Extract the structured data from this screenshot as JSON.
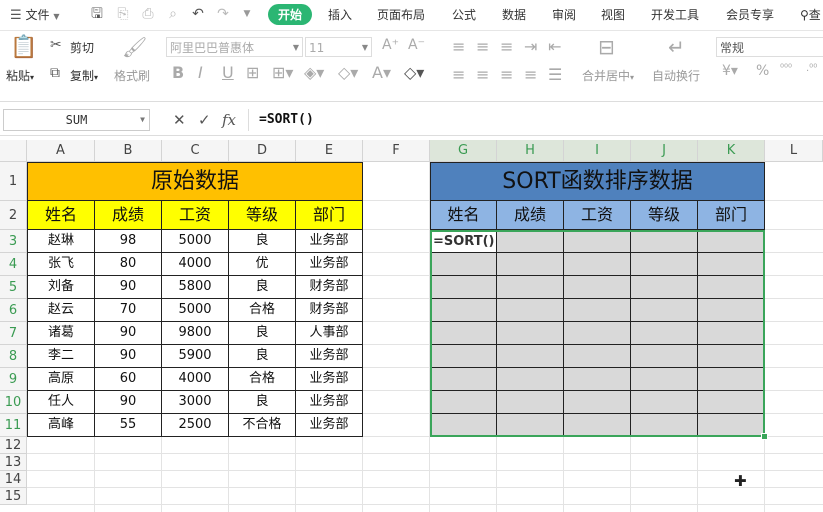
{
  "menubar": {
    "file": "文件",
    "tabs": [
      "开始",
      "插入",
      "页面布局",
      "公式",
      "数据",
      "审阅",
      "视图",
      "开发工具",
      "会员专享"
    ],
    "active_tab": "开始",
    "search_partial": "查"
  },
  "ribbon": {
    "paste": "粘贴",
    "cut": "剪切",
    "copy": "复制",
    "format_painter": "格式刷",
    "font_name": "阿里巴巴普惠体",
    "font_size": "11",
    "merge_center": "合并居中",
    "wrap_text": "自动换行",
    "number_format": "常规"
  },
  "formula_bar": {
    "name_box": "SUM",
    "formula": "=SORT()"
  },
  "sheet": {
    "columns": [
      "A",
      "B",
      "C",
      "D",
      "E",
      "F",
      "G",
      "H",
      "I",
      "J",
      "K",
      "L"
    ],
    "rows": [
      "1",
      "2",
      "3",
      "4",
      "5",
      "6",
      "7",
      "8",
      "9",
      "10",
      "11",
      "12",
      "13",
      "14",
      "15"
    ],
    "left_title": "原始数据",
    "right_title": "SORT函数排序数据",
    "headers": [
      "姓名",
      "成绩",
      "工资",
      "等级",
      "部门"
    ],
    "data": [
      [
        "赵琳",
        "98",
        "5000",
        "良",
        "业务部"
      ],
      [
        "张飞",
        "80",
        "4000",
        "优",
        "业务部"
      ],
      [
        "刘备",
        "90",
        "5800",
        "良",
        "财务部"
      ],
      [
        "赵云",
        "70",
        "5000",
        "合格",
        "财务部"
      ],
      [
        "诸葛",
        "90",
        "9800",
        "良",
        "人事部"
      ],
      [
        "李二",
        "90",
        "5900",
        "良",
        "业务部"
      ],
      [
        "高原",
        "60",
        "4000",
        "合格",
        "业务部"
      ],
      [
        "任人",
        "90",
        "3000",
        "良",
        "业务部"
      ],
      [
        "高峰",
        "55",
        "2500",
        "不合格",
        "业务部"
      ]
    ],
    "editing_cell_text": "=SORT()"
  },
  "colors": {
    "accent": "#2bb673",
    "left_title_bg": "#ffc000",
    "left_header_bg": "#ffff00",
    "right_title_bg": "#4f81bd",
    "right_header_bg": "#8eb4e3",
    "selection": "#3aa55a",
    "empty_cell": "#d9d9d9"
  }
}
